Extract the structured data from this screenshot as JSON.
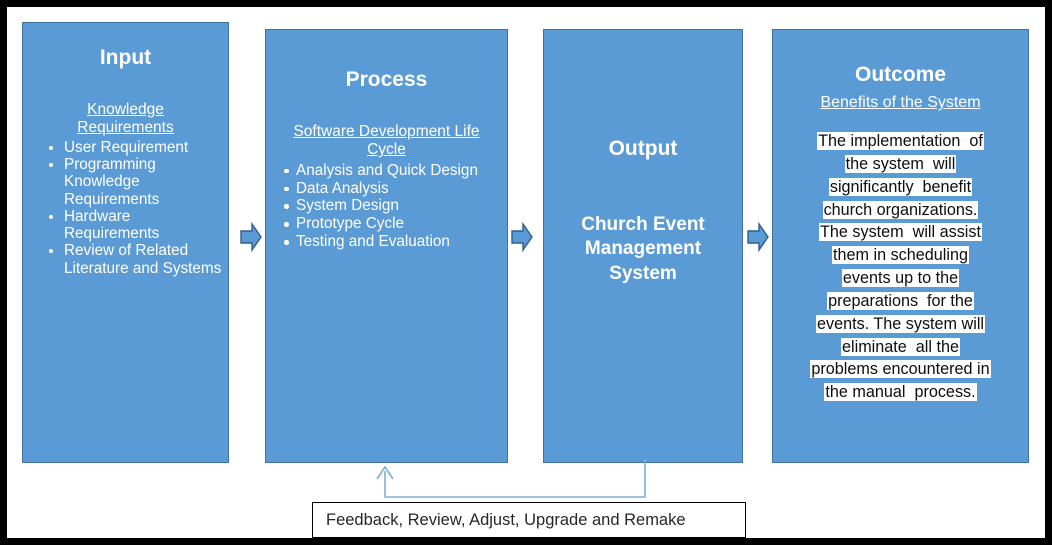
{
  "diagram": {
    "accent_color": "#5B9BD5",
    "accent_border_color": "#41719C",
    "frame_color": "#000000",
    "highlight_bg": "#FFFFFF",
    "columns": {
      "input": {
        "title": "Input",
        "subtitle": "Knowledge  Requirements",
        "items": [
          "User Requirement",
          "Programming Knowledge Requirements",
          "Hardware Requirements",
          "Review of Related Literature and Systems"
        ]
      },
      "process": {
        "title": "Process",
        "subtitle": "Software Development  Life Cycle",
        "items": [
          "Analysis and Quick Design",
          "Data Analysis",
          "System Design",
          "Prototype Cycle",
          "Testing and Evaluation"
        ]
      },
      "output": {
        "title": "Output",
        "body": "Church Event Management System"
      },
      "outcome": {
        "title": "Outcome",
        "subtitle": "Benefits of the System",
        "paragraph_lines": [
          "The implementation  of",
          "the system  will",
          "significantly  benefit",
          "church organizations.",
          "The system  will assist",
          "them in scheduling",
          "events up to the",
          "preparations  for the",
          "events. The system will",
          "eliminate  all the",
          "problems encountered in",
          "the manual  process."
        ]
      }
    },
    "feedback": {
      "label": "Feedback, Review, Adjust, Upgrade and Remake"
    },
    "arrows": {
      "input_to_process": "right-arrow",
      "process_to_output": "right-arrow",
      "output_to_outcome": "right-arrow",
      "feedback_loop": "feedback-arrow-up"
    }
  }
}
